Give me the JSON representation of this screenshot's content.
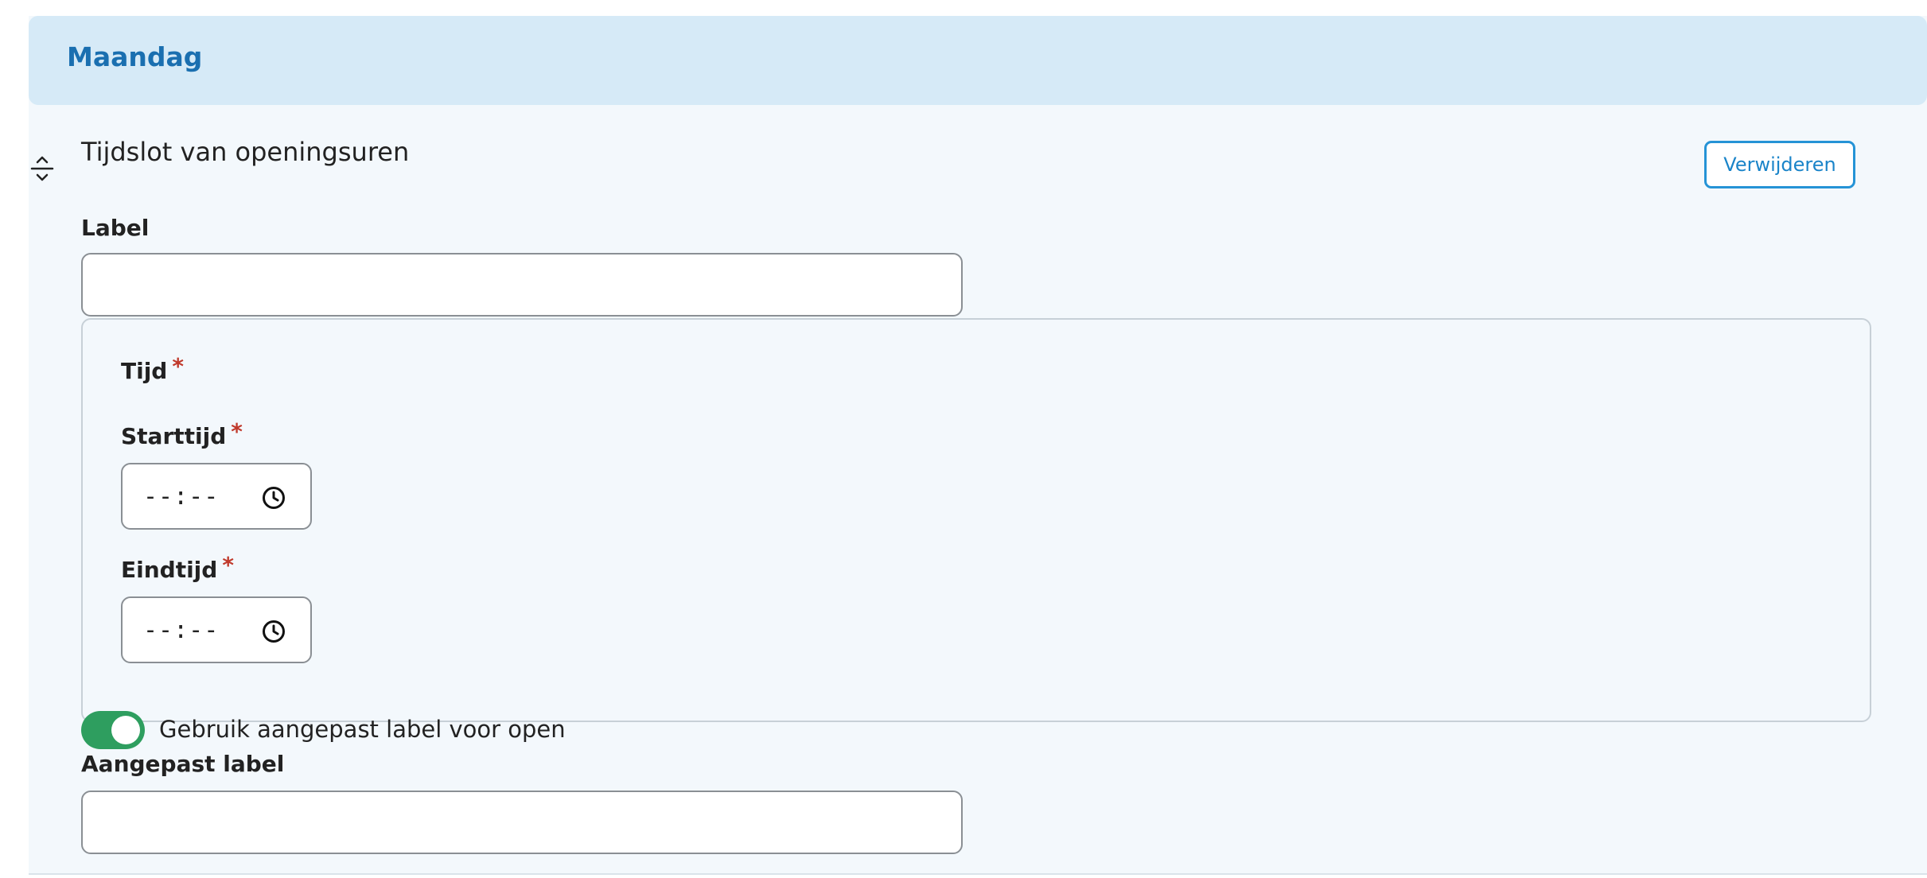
{
  "day": {
    "title": "Maandag"
  },
  "slot": {
    "title": "Tijdslot van openingsuren",
    "remove_label": "Verwijderen",
    "label_field": {
      "label": "Label",
      "value": ""
    },
    "time_group": {
      "legend": "Tijd",
      "required_mark": "*",
      "start": {
        "label": "Starttijd",
        "value": "--:--"
      },
      "end": {
        "label": "Eindtijd",
        "value": "--:--"
      }
    },
    "custom_label_toggle": {
      "label": "Gebruik aangepast label voor open",
      "checked": true
    },
    "custom_label_field": {
      "label": "Aangepast label",
      "value": ""
    }
  },
  "colors": {
    "accent": "#1a6fb0",
    "toggle_on": "#2e9e5f",
    "required": "#c0392b"
  },
  "icons": [
    "drag-handle-icon",
    "clock-icon"
  ]
}
